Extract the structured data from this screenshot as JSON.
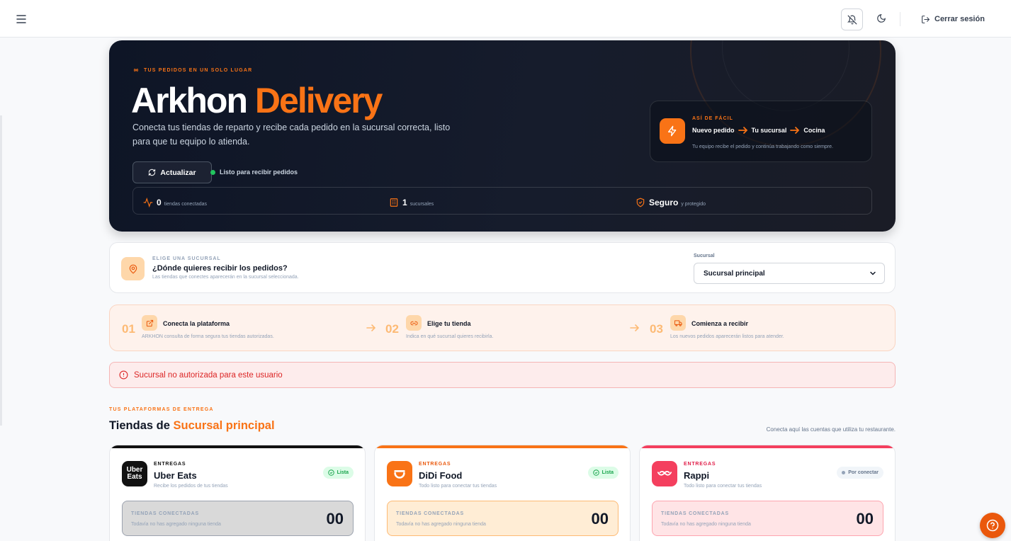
{
  "header": {
    "logout_label": "Cerrar sesión"
  },
  "hero": {
    "eyebrow": "TUS PEDIDOS EN UN SOLO LUGAR",
    "title_main": "Arkhon ",
    "title_accent": "Delivery",
    "description": "Conecta tus tiendas de reparto y recibe cada pedido en la sucursal correcta, listo para que tu equipo lo atienda.",
    "refresh_label": "Actualizar",
    "status_text": "Listo para recibir pedidos",
    "easy": {
      "label": "ASÍ DE FÁCIL",
      "step1": "Nuevo pedido",
      "step2": "Tu sucursal",
      "step3": "Cocina",
      "foot": "Tu equipo recibe el pedido y continúa trabajando como siempre."
    },
    "stats": [
      {
        "value": "0",
        "label": "tiendas conectadas"
      },
      {
        "value": "1",
        "label": "sucursales"
      },
      {
        "value": "Seguro",
        "label": "y protegido"
      }
    ]
  },
  "branch": {
    "eyebrow": "ELIGE UNA SUCURSAL",
    "question": "¿Dónde quieres recibir los pedidos?",
    "sub": "Las tiendas que conectes aparecerán en la sucursal seleccionada.",
    "select_label": "Sucursal",
    "select_value": "Sucursal principal"
  },
  "steps": [
    {
      "num": "01",
      "title": "Conecta la plataforma",
      "sub": "ARKHON consulta de forma segura tus tiendas autorizadas."
    },
    {
      "num": "02",
      "title": "Elige tu tienda",
      "sub": "Indica en qué sucursal quieres recibirla."
    },
    {
      "num": "03",
      "title": "Comienza a recibir",
      "sub": "Los nuevos pedidos aparecerán listos para atender."
    }
  ],
  "error": {
    "message": "Sucursal no autorizada para este usuario"
  },
  "section": {
    "eyebrow": "TUS PLATAFORMAS DE ENTREGA",
    "title_prefix": "Tiendas de ",
    "title_accent": "Sucursal principal",
    "right_text": "Conecta aquí las cuentas que utiliza tu restaurante."
  },
  "platforms": [
    {
      "eyebrow": "ENTREGAS",
      "name": "Uber Eats",
      "logo_text_1": "Uber",
      "logo_text_2": "Eats",
      "sub": "Recibe los pedidos de tus tiendas",
      "badge": "Lista",
      "conn_label": "TIENDAS CONECTADAS",
      "conn_sub": "Todavía no has agregado ninguna tienda",
      "count": "00",
      "accent": "#111111"
    },
    {
      "eyebrow": "ENTREGAS",
      "name": "DiDi Food",
      "sub": "Todo listo para conectar tus tiendas",
      "badge": "Lista",
      "conn_label": "TIENDAS CONECTADAS",
      "conn_sub": "Todavía no has agregado ninguna tienda",
      "count": "00",
      "accent": "#f97316"
    },
    {
      "eyebrow": "ENTREGAS",
      "name": "Rappi",
      "sub": "Todo listo para conectar tus tiendas",
      "badge": "Por conectar",
      "conn_label": "TIENDAS CONECTADAS",
      "conn_sub": "Todavía no has agregado ninguna tienda",
      "count": "00",
      "accent": "#f43f5e"
    }
  ],
  "colors": {
    "brand_orange": "#f97316",
    "error_red": "#dc2626",
    "success_green": "#22c55e"
  },
  "icons": [
    "menu-icon",
    "bell-off-icon",
    "moon-icon",
    "logout-icon",
    "broadcast-icon",
    "refresh-icon",
    "zap-icon",
    "arrow-right-icon",
    "activity-icon",
    "building-icon",
    "shield-check-icon",
    "map-pin-icon",
    "chevron-down-icon",
    "external-link-icon",
    "link-icon",
    "truck-icon",
    "alert-circle-icon",
    "check-circle-icon",
    "help-icon"
  ]
}
